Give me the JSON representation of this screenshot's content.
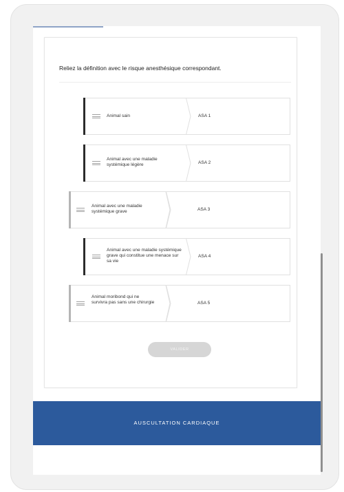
{
  "question": "Reliez la définition avec le risque anesthésique correspondant.",
  "definitions": [
    {
      "label": "Animal sain",
      "selected": true
    },
    {
      "label": "Animal avec une maladie systémique légère",
      "selected": true
    },
    {
      "label": "Animal avec une maladie systémique grave",
      "selected": false
    },
    {
      "label": "Animal avec une maladie systémique grave qui constitue une menace sur sa vie",
      "selected": true
    },
    {
      "label": "Animal moribond qui ne survivra pas sans une chirurgie",
      "selected": false
    }
  ],
  "answers": [
    "ASA 1",
    "ASA 2",
    "ASA 3",
    "ASA 4",
    "ASA 5"
  ],
  "submit_label": "VALIDER",
  "next_section": "AUSCULTATION CARDIAQUE",
  "colors": {
    "accent": "#2c5a9c",
    "selected_bar": "#2b2b2b",
    "unselected_bar": "#b5b5b5"
  }
}
